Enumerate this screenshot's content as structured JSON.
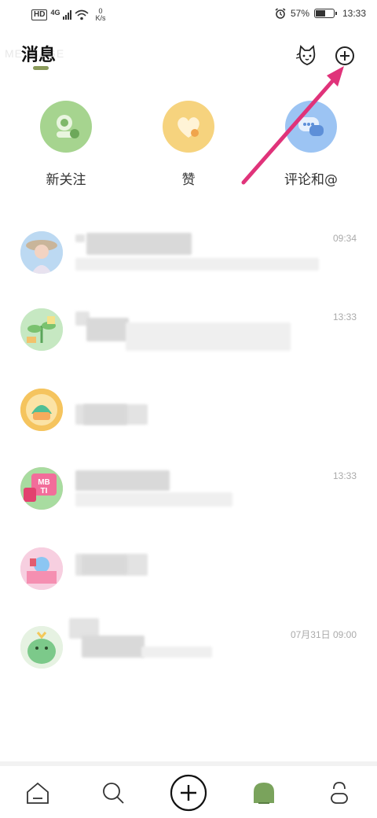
{
  "status_bar": {
    "network": "HD",
    "network_gen": "4G",
    "speed_value": "0",
    "speed_unit": "K/s",
    "battery": "57%",
    "battery_level": 0.57,
    "time": "13:33"
  },
  "header": {
    "title": "消息",
    "ghost_text": "MESSAGE",
    "icons": [
      "cat-mascot-icon",
      "add-circle-icon"
    ]
  },
  "quick_entries": [
    {
      "label": "新关注",
      "icon": "new-follow-icon",
      "color": "#9ccf86"
    },
    {
      "label": "赞",
      "icon": "heart-icon",
      "color": "#f5d27a"
    },
    {
      "label": "评论和@",
      "icon": "comment-bubble-icon",
      "color": "#8ab8f0"
    }
  ],
  "messages": [
    {
      "time": "09:34",
      "avatar": "woman-hat-avatar"
    },
    {
      "time": "13:33",
      "avatar": "green-plant-avatar"
    },
    {
      "time": "",
      "avatar": "yellow-mascot-avatar"
    },
    {
      "time": "13:33",
      "avatar": "mbti-avatar"
    },
    {
      "time": "",
      "avatar": "pink-castle-avatar"
    },
    {
      "time": "07月31日 09:00",
      "avatar": "green-dino-avatar"
    }
  ],
  "tabbar": [
    "home-icon",
    "search-icon",
    "add-icon",
    "messages-icon",
    "profile-icon"
  ],
  "colors": {
    "accent": "#8a9a5b",
    "arrow": "#e0337a",
    "time_gray": "#aaaaaa"
  }
}
